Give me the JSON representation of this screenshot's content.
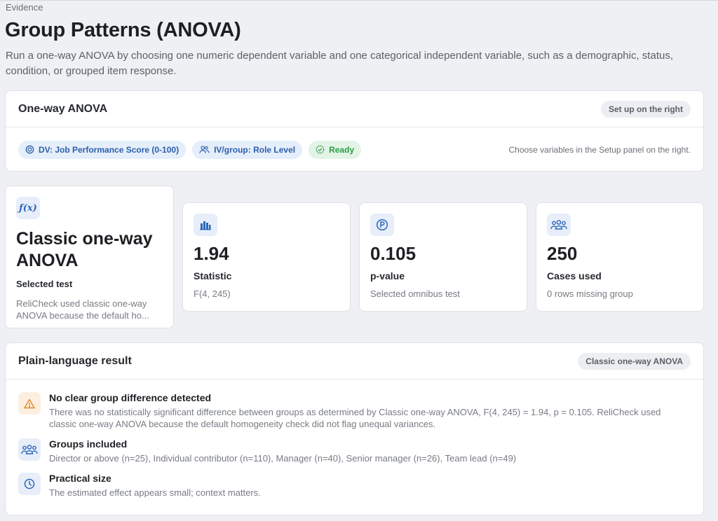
{
  "page": {
    "eyebrow": "Evidence",
    "title": "Group Patterns (ANOVA)",
    "subtitle": "Run a one-way ANOVA by choosing one numeric dependent variable and one categorical independent variable, such as a demographic, status, condition, or grouped item response."
  },
  "setup": {
    "title": "One-way ANOVA",
    "badge": "Set up on the right",
    "dv_chip": "DV: Job Performance Score (0-100)",
    "iv_chip": "IV/group: Role Level",
    "status_chip": "Ready",
    "hint": "Choose variables in the Setup panel on the right."
  },
  "stats": {
    "test": {
      "value": "Classic one-way ANOVA",
      "label": "Selected test",
      "sub": "ReliCheck used classic one-way ANOVA because the default ho..."
    },
    "statistic": {
      "value": "1.94",
      "label": "Statistic",
      "sub": "F(4, 245)"
    },
    "pvalue": {
      "value": "0.105",
      "label": "p-value",
      "sub": "Selected omnibus test"
    },
    "cases": {
      "value": "250",
      "label": "Cases used",
      "sub": "0 rows missing group"
    }
  },
  "result": {
    "title": "Plain-language result",
    "badge": "Classic one-way ANOVA",
    "items": [
      {
        "icon": "warning-icon",
        "title": "No clear group difference detected",
        "text": "There was no statistically significant difference between groups as determined by Classic one-way ANOVA, F(4, 245) = 1.94, p = 0.105. ReliCheck used classic one-way ANOVA because the default homogeneity check did not flag unequal variances."
      },
      {
        "icon": "groups-icon",
        "title": "Groups included",
        "text": "Director or above (n=25), Individual contributor (n=110), Manager (n=40), Senior manager (n=26), Team lead (n=49)"
      },
      {
        "icon": "pie-chart-icon",
        "title": "Practical size",
        "text": "The estimated effect appears small; context matters."
      }
    ]
  },
  "colors": {
    "accent": "#2c66b8",
    "ready": "#2e9a48",
    "warning": "#e08a2a",
    "background": "#eff0f3"
  }
}
